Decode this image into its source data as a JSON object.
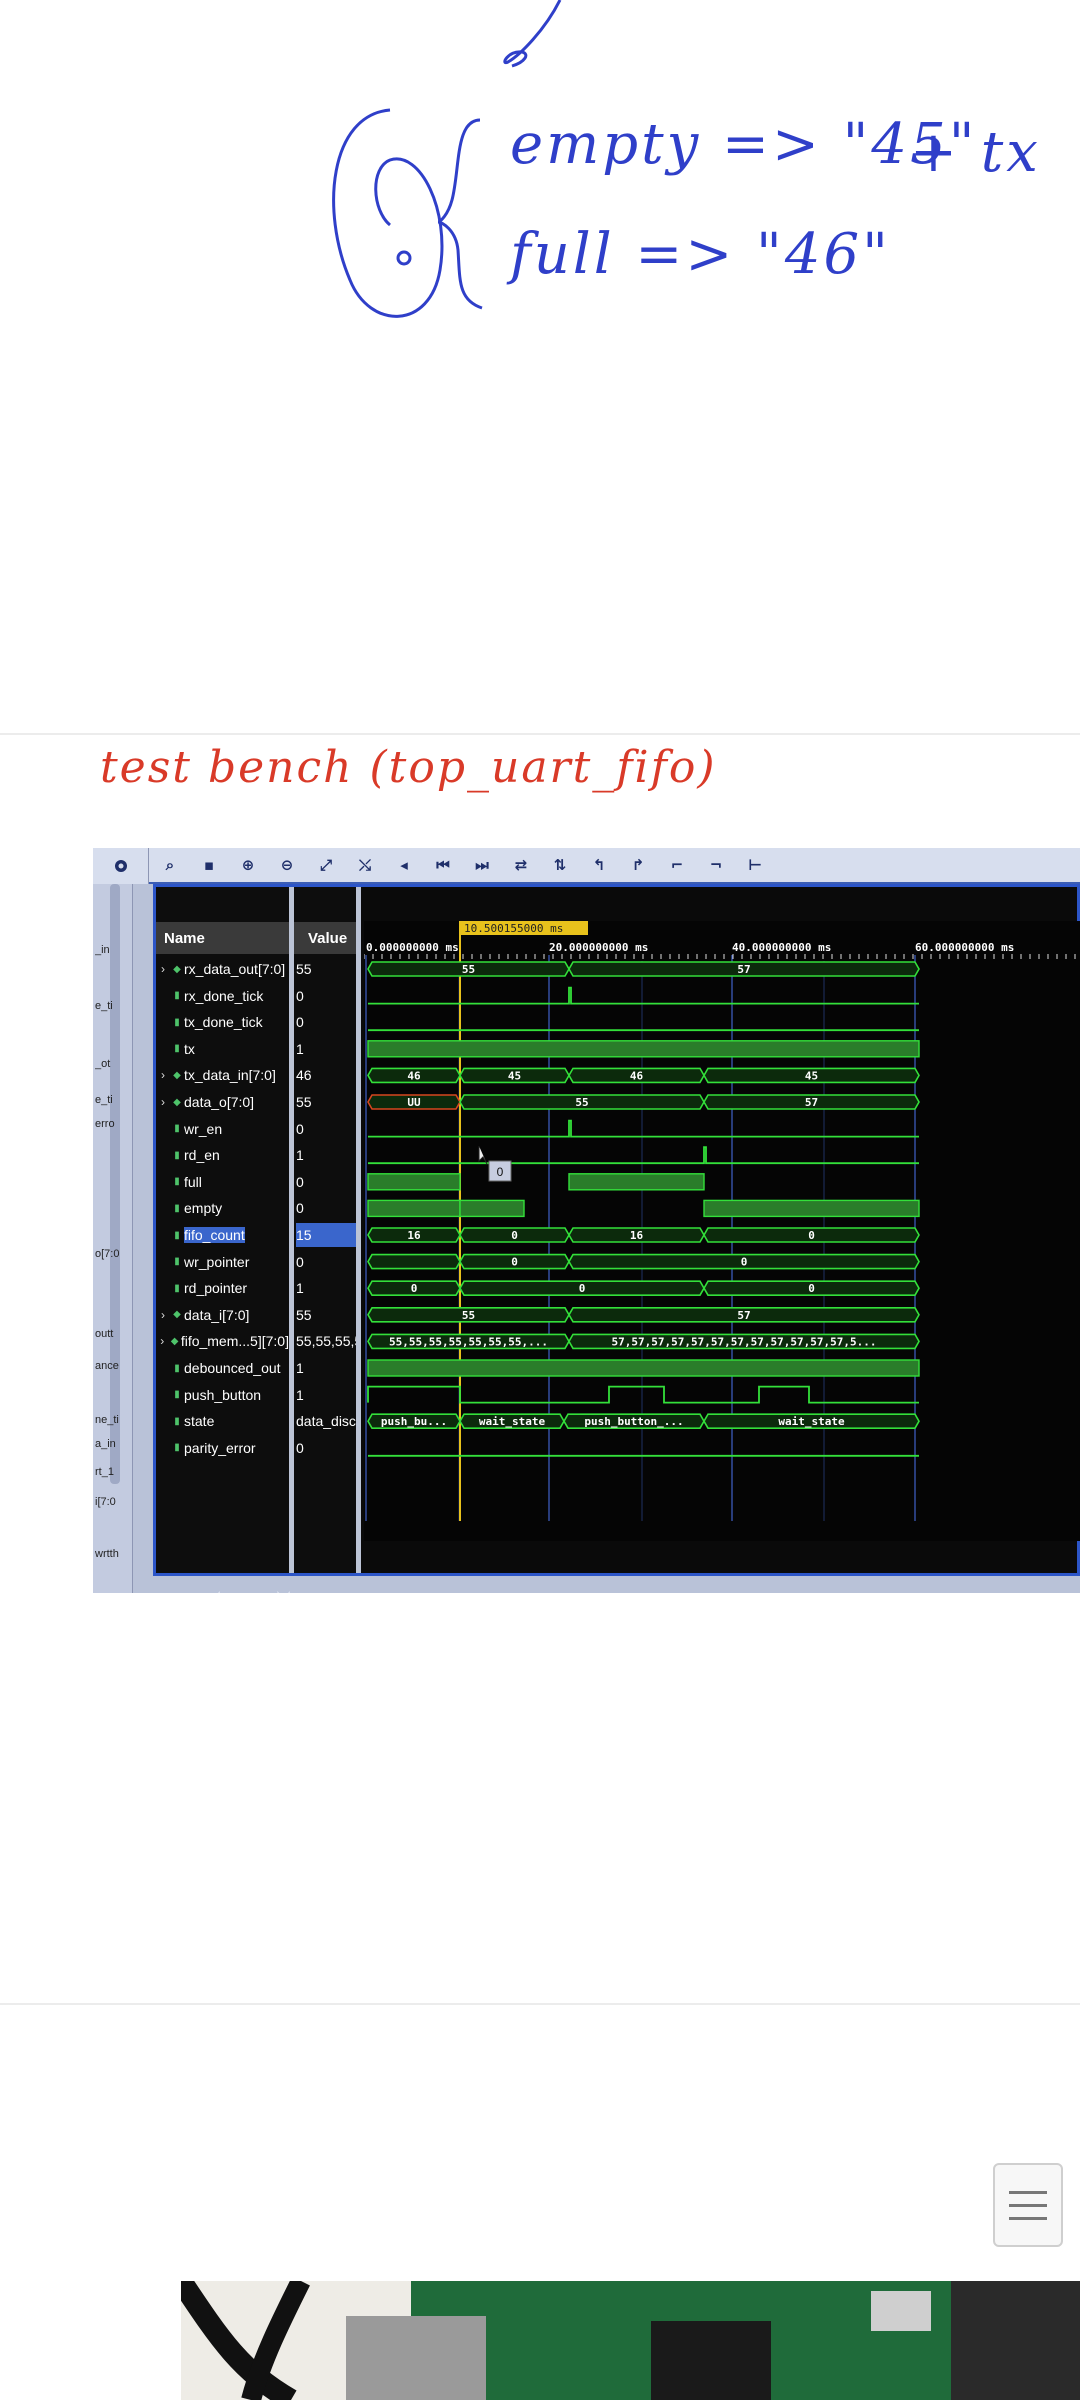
{
  "notes": {
    "handwritten_line1": "empty => \"45\"",
    "handwritten_plus": "+ tx",
    "handwritten_line2": "full => \"46\"",
    "caption": "test bench (top_uart_fifo)"
  },
  "simulator": {
    "cursor_time": "10.500155000 ms",
    "time_ruler": [
      "0.000000000 ms",
      "20.000000000 ms",
      "40.000000000 ms",
      "60.000000000 ms"
    ],
    "columns": {
      "name": "Name",
      "value": "Value"
    },
    "gutter_labels": [
      "_in",
      "e_ti",
      "_ot",
      "e_ti",
      "erro",
      "o[7:0",
      "outt",
      "ance",
      "ne_ti",
      "a_in",
      "rt_1",
      "i[7:0",
      "wrtth"
    ],
    "signals": [
      {
        "name": "rx_data_out[7:0]",
        "value": "55",
        "bus": true
      },
      {
        "name": "rx_done_tick",
        "value": "0",
        "bus": false
      },
      {
        "name": "tx_done_tick",
        "value": "0",
        "bus": false
      },
      {
        "name": "tx",
        "value": "1",
        "bus": false
      },
      {
        "name": "tx_data_in[7:0]",
        "value": "46",
        "bus": true
      },
      {
        "name": "data_o[7:0]",
        "value": "55",
        "bus": true
      },
      {
        "name": "wr_en",
        "value": "0",
        "bus": false
      },
      {
        "name": "rd_en",
        "value": "1",
        "bus": false
      },
      {
        "name": "full",
        "value": "0",
        "bus": false
      },
      {
        "name": "empty",
        "value": "0",
        "bus": false
      },
      {
        "name": "fifo_count",
        "value": "15",
        "bus": false,
        "selected": true
      },
      {
        "name": "wr_pointer",
        "value": "0",
        "bus": false
      },
      {
        "name": "rd_pointer",
        "value": "1",
        "bus": false
      },
      {
        "name": "data_i[7:0]",
        "value": "55",
        "bus": true
      },
      {
        "name": "fifo_mem...5][7:0]",
        "value": "55,55,55,55",
        "bus": true
      },
      {
        "name": "debounced_out",
        "value": "1",
        "bus": false
      },
      {
        "name": "push_button",
        "value": "1",
        "bus": false
      },
      {
        "name": "state",
        "value": "data_disc",
        "bus": false
      },
      {
        "name": "parity_error",
        "value": "0",
        "bus": false
      }
    ],
    "bus_labels": {
      "rx_data_out": [
        "55",
        "57"
      ],
      "tx_data_in": [
        "46",
        "45",
        "46",
        "45"
      ],
      "data_o": [
        "UU",
        "55",
        "57"
      ],
      "fifo_count": [
        "16",
        "0",
        "16",
        "0"
      ],
      "wr_pointer": [
        "0",
        "0"
      ],
      "rd_pointer": [
        "0",
        "0",
        "0"
      ],
      "data_i": [
        "55",
        "57"
      ],
      "fifo_mem": [
        "55,55,55,55,55,55,55,...",
        "57,57,57,57,57,57,57,57,57,57,57,57,5..."
      ],
      "state": [
        "push_bu...",
        "wait_state",
        "push_button_...",
        "wait_state"
      ]
    },
    "tooltip_value": "0",
    "colors": {
      "wave": "#33e03a",
      "bus_fill": "#0c2a0c",
      "cursor": "#e8c21c",
      "undefined": "#d6461f",
      "grid": "#3f62c9"
    }
  }
}
